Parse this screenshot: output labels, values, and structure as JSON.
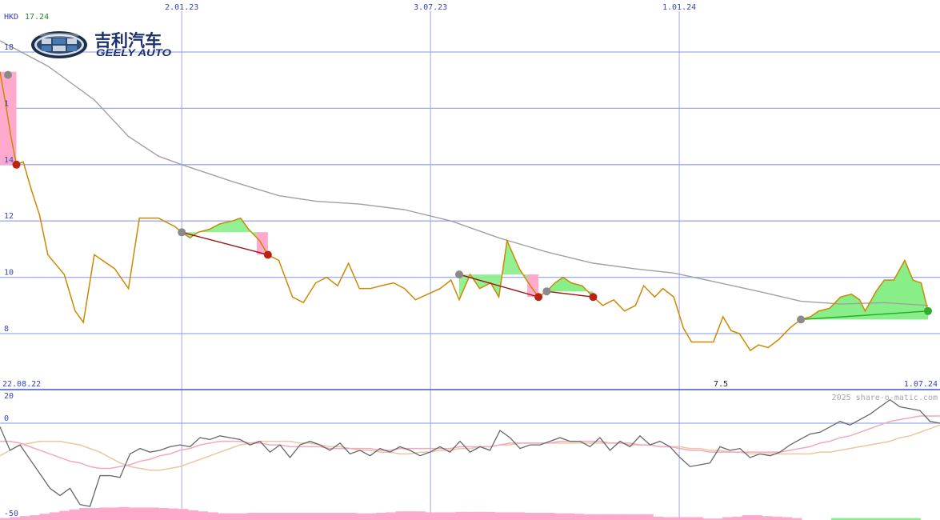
{
  "header": {
    "currency": "HKD",
    "last_price": "17.24",
    "credit": "2025 share-o-matic.com",
    "start_date": "22.08.22",
    "end_date": "1.07.24",
    "volume_label": "7.5"
  },
  "logo": {
    "name_cn": "吉利汽车",
    "name_en": "GEELY AUTO"
  },
  "colors": {
    "price": "#cc8800",
    "ma": "#a0a0a0",
    "grid": "#9aaaf0",
    "gain": "#88ee88",
    "loss": "#ffaacc",
    "up_trend": "#22aa22",
    "down_trend": "#991111",
    "axis_text": "#3344bb"
  },
  "chart_data": [
    {
      "type": "line",
      "panel": "price",
      "y_ticks": [
        "8",
        "10",
        "12",
        "14",
        "1",
        "18"
      ],
      "ylim": [
        6,
        19.8
      ],
      "x_ticks": [
        {
          "label": "2.01.23",
          "date": "2023-01-02"
        },
        {
          "label": "3.07.23",
          "date": "2023-07-03"
        },
        {
          "label": "1.01.24",
          "date": "2024-01-01"
        }
      ],
      "xlim": [
        "2022-08-22",
        "2024-07-01"
      ],
      "series": [
        {
          "role": "price",
          "points": [
            [
              "2022-08-22",
              17.3
            ],
            [
              "2022-08-26",
              16.2
            ],
            [
              "2022-08-30",
              15.0
            ],
            [
              "2022-09-03",
              14.0
            ],
            [
              "2022-09-08",
              14.1
            ],
            [
              "2022-09-14",
              13.1
            ],
            [
              "2022-09-20",
              12.2
            ],
            [
              "2022-09-26",
              10.8
            ],
            [
              "2022-10-08",
              10.1
            ],
            [
              "2022-10-16",
              8.8
            ],
            [
              "2022-10-22",
              8.4
            ],
            [
              "2022-10-30",
              10.8
            ],
            [
              "2022-11-14",
              10.3
            ],
            [
              "2022-11-24",
              9.6
            ],
            [
              "2022-12-02",
              12.1
            ],
            [
              "2022-12-16",
              12.1
            ],
            [
              "2022-12-28",
              11.8
            ],
            [
              "2023-01-02",
              11.6
            ],
            [
              "2023-01-08",
              11.4
            ],
            [
              "2023-01-14",
              11.6
            ],
            [
              "2023-01-22",
              11.7
            ],
            [
              "2023-01-30",
              11.9
            ],
            [
              "2023-02-08",
              12.0
            ],
            [
              "2023-02-14",
              12.1
            ],
            [
              "2023-02-20",
              11.7
            ],
            [
              "2023-02-28",
              11.3
            ],
            [
              "2023-03-06",
              10.8
            ],
            [
              "2023-03-14",
              10.6
            ],
            [
              "2023-03-24",
              9.3
            ],
            [
              "2023-04-01",
              9.1
            ],
            [
              "2023-04-10",
              9.8
            ],
            [
              "2023-04-18",
              10.0
            ],
            [
              "2023-04-26",
              9.7
            ],
            [
              "2023-05-04",
              10.5
            ],
            [
              "2023-05-12",
              9.6
            ],
            [
              "2023-05-20",
              9.6
            ],
            [
              "2023-05-28",
              9.7
            ],
            [
              "2023-06-06",
              9.8
            ],
            [
              "2023-06-14",
              9.6
            ],
            [
              "2023-06-22",
              9.2
            ],
            [
              "2023-07-01",
              9.4
            ],
            [
              "2023-07-10",
              9.6
            ],
            [
              "2023-07-18",
              9.9
            ],
            [
              "2023-07-24",
              9.2
            ],
            [
              "2023-08-01",
              10.1
            ],
            [
              "2023-08-08",
              9.6
            ],
            [
              "2023-08-16",
              9.8
            ],
            [
              "2023-08-22",
              9.3
            ],
            [
              "2023-08-28",
              11.3
            ],
            [
              "2023-09-06",
              10.3
            ],
            [
              "2023-09-14",
              9.7
            ],
            [
              "2023-09-20",
              9.3
            ],
            [
              "2023-09-26",
              9.5
            ],
            [
              "2023-10-02",
              9.8
            ],
            [
              "2023-10-08",
              10.0
            ],
            [
              "2023-10-14",
              9.8
            ],
            [
              "2023-10-22",
              9.7
            ],
            [
              "2023-10-30",
              9.3
            ],
            [
              "2023-11-06",
              9.0
            ],
            [
              "2023-11-14",
              9.2
            ],
            [
              "2023-11-22",
              8.8
            ],
            [
              "2023-11-30",
              9.0
            ],
            [
              "2023-12-06",
              9.7
            ],
            [
              "2023-12-14",
              9.3
            ],
            [
              "2023-12-20",
              9.6
            ],
            [
              "2023-12-28",
              9.3
            ],
            [
              "2024-01-04",
              8.2
            ],
            [
              "2024-01-10",
              7.7
            ],
            [
              "2024-01-18",
              7.7
            ],
            [
              "2024-01-26",
              7.7
            ],
            [
              "2024-02-02",
              8.6
            ],
            [
              "2024-02-08",
              8.1
            ],
            [
              "2024-02-14",
              8.0
            ],
            [
              "2024-02-22",
              7.4
            ],
            [
              "2024-02-28",
              7.6
            ],
            [
              "2024-03-06",
              7.5
            ],
            [
              "2024-03-14",
              7.8
            ],
            [
              "2024-03-22",
              8.2
            ],
            [
              "2024-03-30",
              8.5
            ],
            [
              "2024-04-06",
              8.6
            ],
            [
              "2024-04-12",
              8.8
            ],
            [
              "2024-04-20",
              8.9
            ],
            [
              "2024-04-28",
              9.3
            ],
            [
              "2024-05-06",
              9.4
            ],
            [
              "2024-05-12",
              9.2
            ],
            [
              "2024-05-16",
              8.8
            ],
            [
              "2024-05-24",
              9.5
            ],
            [
              "2024-05-30",
              9.9
            ],
            [
              "2024-06-06",
              9.9
            ],
            [
              "2024-06-14",
              10.6
            ],
            [
              "2024-06-20",
              9.9
            ],
            [
              "2024-06-26",
              9.8
            ],
            [
              "2024-07-01",
              8.8
            ]
          ]
        },
        {
          "role": "moving-average",
          "points": [
            [
              "2022-08-22",
              18.4
            ],
            [
              "2022-09-26",
              17.5
            ],
            [
              "2022-10-30",
              16.3
            ],
            [
              "2022-11-24",
              15.0
            ],
            [
              "2022-12-16",
              14.3
            ],
            [
              "2023-01-02",
              14.0
            ],
            [
              "2023-02-08",
              13.4
            ],
            [
              "2023-03-14",
              12.9
            ],
            [
              "2023-04-10",
              12.7
            ],
            [
              "2023-05-12",
              12.6
            ],
            [
              "2023-06-14",
              12.4
            ],
            [
              "2023-07-18",
              12.0
            ],
            [
              "2023-08-22",
              11.4
            ],
            [
              "2023-09-26",
              10.9
            ],
            [
              "2023-10-30",
              10.5
            ],
            [
              "2023-11-30",
              10.3
            ],
            [
              "2023-12-28",
              10.15
            ],
            [
              "2024-01-26",
              9.85
            ],
            [
              "2024-02-28",
              9.5
            ],
            [
              "2024-03-30",
              9.15
            ],
            [
              "2024-04-28",
              9.05
            ],
            [
              "2024-05-30",
              9.1
            ],
            [
              "2024-07-01",
              9.0
            ]
          ]
        }
      ],
      "trend_signals": [
        {
          "direction": "down",
          "from": [
            "2023-01-02",
            11.6
          ],
          "to": [
            "2023-03-06",
            10.8
          ]
        },
        {
          "direction": "down",
          "from": [
            "2023-07-24",
            10.1
          ],
          "to": [
            "2023-09-20",
            9.3
          ]
        },
        {
          "direction": "down",
          "from": [
            "2023-09-26",
            9.5
          ],
          "to": [
            "2023-10-30",
            9.3
          ]
        },
        {
          "direction": "up",
          "from": [
            "2024-03-30",
            8.5
          ],
          "to": [
            "2024-07-01",
            8.8
          ]
        }
      ],
      "gain_loss_zones": [
        {
          "from": "2022-08-22",
          "to": "2022-09-03",
          "base": 17.3,
          "kind": "loss"
        },
        {
          "from": "2023-01-02",
          "to": "2023-03-06",
          "base": 11.6,
          "kind": "mixed"
        },
        {
          "from": "2023-07-24",
          "to": "2023-09-20",
          "base": 10.1,
          "kind": "mixed"
        },
        {
          "from": "2023-09-26",
          "to": "2023-10-30",
          "base": 9.5,
          "kind": "gain"
        },
        {
          "from": "2024-03-30",
          "to": "2024-07-01",
          "base": 8.5,
          "kind": "gain"
        }
      ]
    },
    {
      "type": "line",
      "panel": "oscillator",
      "y_ticks": [
        "20",
        "0",
        "-50"
      ],
      "ylim": [
        -50,
        20
      ],
      "series": [
        {
          "role": "oscillator",
          "values": [
            -2,
            -15,
            -12,
            -20,
            -28,
            -36,
            -40,
            -36,
            -45,
            -46,
            -29,
            -29,
            -30,
            -17,
            -14,
            -16,
            -15,
            -13,
            -12,
            -13,
            -8,
            -9,
            -7,
            -8,
            -9,
            -12,
            -10,
            -16,
            -12,
            -19,
            -12,
            -10,
            -12,
            -15,
            -11,
            -17,
            -15,
            -18,
            -14,
            -16,
            -13,
            -15,
            -18,
            -16,
            -13,
            -16,
            -10,
            -16,
            -13,
            -15,
            -4,
            -8,
            -14,
            -12,
            -12,
            -10,
            -8,
            -10,
            -10,
            -13,
            -8,
            -15,
            -10,
            -13,
            -7,
            -12,
            -10,
            -13,
            -19,
            -24,
            -23,
            -22,
            -13,
            -15,
            -14,
            -19,
            -17,
            -18,
            -16,
            -12,
            -9,
            -6,
            -5,
            -2,
            1,
            -1,
            2,
            5,
            9,
            13,
            9,
            8,
            7,
            1,
            0
          ]
        },
        {
          "role": "signal-fast",
          "values": [
            -10,
            -10,
            -11,
            -13,
            -15,
            -17,
            -19,
            -21,
            -22,
            -24,
            -25,
            -25,
            -24,
            -23,
            -21,
            -20,
            -18,
            -17,
            -15,
            -14,
            -12,
            -11,
            -10,
            -10,
            -10,
            -11,
            -11,
            -12,
            -12,
            -13,
            -13,
            -13,
            -13,
            -14,
            -14,
            -14,
            -14,
            -14,
            -15,
            -15,
            -14,
            -14,
            -14,
            -14,
            -14,
            -14,
            -13,
            -13,
            -13,
            -13,
            -12,
            -11,
            -11,
            -11,
            -11,
            -11,
            -10,
            -10,
            -10,
            -10,
            -10,
            -11,
            -11,
            -11,
            -12,
            -12,
            -13,
            -13,
            -14,
            -15,
            -15,
            -16,
            -16,
            -16,
            -16,
            -16,
            -16,
            -16,
            -16,
            -15,
            -14,
            -13,
            -11,
            -10,
            -8,
            -7,
            -5,
            -3,
            -1,
            1,
            2,
            3,
            4,
            4,
            4
          ]
        },
        {
          "role": "signal-slow",
          "values": [
            -18,
            -15,
            -12,
            -11,
            -10,
            -10,
            -10,
            -11,
            -12,
            -14,
            -16,
            -19,
            -22,
            -24,
            -25,
            -26,
            -26,
            -25,
            -24,
            -22,
            -20,
            -18,
            -16,
            -14,
            -12,
            -11,
            -10,
            -10,
            -10,
            -10,
            -11,
            -11,
            -12,
            -13,
            -13,
            -14,
            -15,
            -15,
            -16,
            -16,
            -17,
            -17,
            -16,
            -16,
            -15,
            -15,
            -14,
            -14,
            -13,
            -13,
            -12,
            -12,
            -11,
            -11,
            -11,
            -11,
            -11,
            -11,
            -11,
            -11,
            -11,
            -11,
            -11,
            -12,
            -12,
            -12,
            -13,
            -13,
            -13,
            -14,
            -14,
            -15,
            -15,
            -16,
            -16,
            -17,
            -17,
            -17,
            -17,
            -17,
            -17,
            -17,
            -16,
            -16,
            -15,
            -14,
            -13,
            -12,
            -11,
            -10,
            -8,
            -7,
            -5,
            -3,
            -1
          ]
        }
      ]
    },
    {
      "type": "bar",
      "panel": "momentum-histogram",
      "values": [
        -0.4,
        -0.6,
        -0.8,
        -1.0,
        -1.3,
        -1.6,
        -1.9,
        -2.2,
        -2.5,
        -2.5,
        -2.6,
        -2.6,
        -2.7,
        -2.6,
        -2.6,
        -2.6,
        -2.5,
        -2.4,
        -2.3,
        -2.0,
        -1.8,
        -1.6,
        -1.4,
        -1.4,
        -1.4,
        -1.5,
        -1.5,
        -1.5,
        -1.5,
        -1.5,
        -1.5,
        -1.5,
        -1.5,
        -1.5,
        -1.5,
        -1.5,
        -1.4,
        -1.4,
        -1.5,
        -1.6,
        -1.8,
        -1.8,
        -1.8,
        -1.6,
        -1.6,
        -1.6,
        -1.7,
        -1.7,
        -1.7,
        -1.7,
        -1.6,
        -1.6,
        -1.6,
        -1.5,
        -1.5,
        -1.5,
        -1.4,
        -1.4,
        -1.3,
        -1.2,
        -1.2,
        -1.2,
        -1.2,
        -1.2,
        -1.2,
        -1.2,
        -0.7,
        -0.6,
        -0.6,
        -0.6,
        -0.6,
        -0.3,
        -0.3,
        -0.6,
        -0.7,
        -1.0,
        -1.0,
        -0.8,
        -0.7,
        -0.6,
        -0.4,
        0,
        0,
        0,
        0.4,
        0.4,
        0.4,
        0.4,
        0.4,
        0.4,
        0.4,
        0.4,
        0.4,
        0,
        0
      ]
    }
  ]
}
